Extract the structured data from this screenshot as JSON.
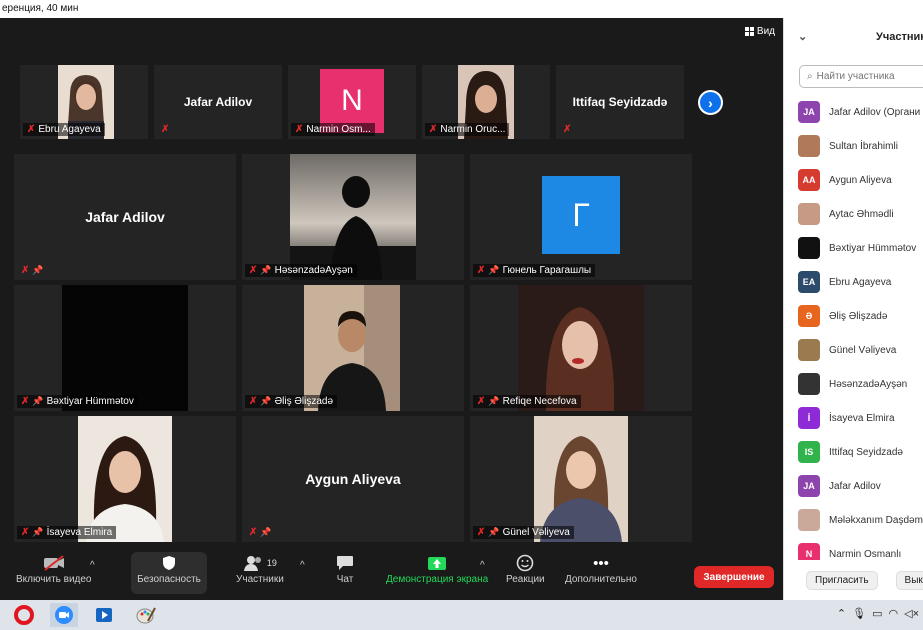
{
  "window": {
    "title": "еренция, 40 мин"
  },
  "view_button": {
    "label": "Вид"
  },
  "top_strip": [
    {
      "name": "Ebru Agayeva",
      "type": "video",
      "color": "#d8c8bb"
    },
    {
      "name": "Jafar Adilov",
      "type": "name"
    },
    {
      "name": "Narmin Osm...",
      "type": "avatar",
      "letter": "N",
      "color": "#e8306f"
    },
    {
      "name": "Narmin Oruc...",
      "type": "video",
      "color": "#cdb2a4"
    },
    {
      "name": "Ittifaq Seyidzadə",
      "type": "name"
    }
  ],
  "grid_tiles": [
    {
      "name": "Jafar Adilov",
      "type": "name",
      "center_label": "Jafar Adilov"
    },
    {
      "name": "HəsənzadəAyşən",
      "type": "video",
      "color": "#3a3a3a"
    },
    {
      "name": "Гюнель Гарагашлы",
      "type": "avatar",
      "letter": "Г",
      "color": "#1e88e5"
    },
    {
      "name": "Bəxtiyar Hümmətov",
      "type": "video",
      "color": "#050505"
    },
    {
      "name": "Əliş Əlişzadə",
      "type": "video",
      "color": "#b9a38e"
    },
    {
      "name": "Refiqe Necefova",
      "type": "video",
      "color": "#4a2a28"
    },
    {
      "name": "İsayeva Elmira",
      "type": "video",
      "color": "#e6e0da"
    },
    {
      "name": "",
      "type": "name",
      "center_label": "Aygun Aliyeva"
    },
    {
      "name": "Günel Vəliyeva",
      "type": "video",
      "color": "#d6c2b0"
    }
  ],
  "toolbar": {
    "video_label": "Включить видео",
    "security_label": "Безопасность",
    "participants_label": "Участники",
    "participants_count": "19",
    "chat_label": "Чат",
    "share_label": "Демонстрация экрана",
    "reactions_label": "Реакции",
    "more_label": "Дополнительно",
    "end_label": "Завершение"
  },
  "panel": {
    "title": "Участники",
    "search_placeholder": "Найти участника",
    "participants": [
      {
        "name": "Jafar Adilov (Органи",
        "initials": "JA",
        "color": "#8e44ad"
      },
      {
        "name": "Sultan İbrahimli",
        "initials": "",
        "color": "#b07a5a"
      },
      {
        "name": "Aygun Aliyeva",
        "initials": "AA",
        "color": "#d63b2f"
      },
      {
        "name": "Aytac Əhmədli",
        "initials": "",
        "color": "#c79a86"
      },
      {
        "name": "Bəxtiyar Hümmətov",
        "initials": "",
        "color": "#111111"
      },
      {
        "name": "Ebru Agayeva",
        "initials": "EA",
        "color": "#2c4a6b"
      },
      {
        "name": "Əliş Əlişzadə",
        "initials": "Ə",
        "color": "#e8651f"
      },
      {
        "name": "Günel Vəliyeva",
        "initials": "",
        "color": "#9c7a50"
      },
      {
        "name": "HəsənzadəAyşən",
        "initials": "",
        "color": "#333333"
      },
      {
        "name": "İsayeva Elmira",
        "initials": "İ",
        "color": "#8e2bd6"
      },
      {
        "name": "Ittifaq Seyidzadə",
        "initials": "IS",
        "color": "#2fb34a"
      },
      {
        "name": "Jafar Adilov",
        "initials": "JA",
        "color": "#8e44ad"
      },
      {
        "name": "Mələkxanım Daşdəm",
        "initials": "",
        "color": "#caa99a"
      },
      {
        "name": "Narmin Osmanlı",
        "initials": "N",
        "color": "#e8306f"
      }
    ],
    "invite_label": "Пригласить",
    "mute_label": "Выкл"
  }
}
